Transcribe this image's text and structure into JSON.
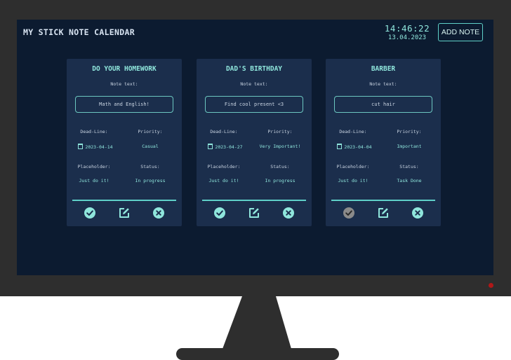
{
  "app": {
    "title": "MY STICK NOTE CALENDAR",
    "time": "14:46:22",
    "date": "13.04.2023",
    "add_note_label": "ADD NOTE"
  },
  "labels": {
    "note_text": "Note text:",
    "deadline": "Dead-Line:",
    "priority": "Priority:",
    "placeholder": "Placeholder:",
    "status": "Status:"
  },
  "colors": {
    "screen_bg": "#0c1b30",
    "card_bg": "#1b2e4c",
    "accent": "#8fe6dc",
    "done_gray": "#8a8a8a"
  },
  "notes": [
    {
      "title": "DO YOUR HOMEWORK",
      "text": "Math and English!",
      "deadline": "2023-04-14",
      "priority": "Casual",
      "placeholder": "Just do it!",
      "status": "In progress",
      "done": false
    },
    {
      "title": "DAD'S BIRTHDAY",
      "text": "Find cool present <3",
      "deadline": "2023-04-27",
      "priority": "Very Important!",
      "placeholder": "Just do it!",
      "status": "In progress",
      "done": false
    },
    {
      "title": "BARBER",
      "text": "cut hair",
      "deadline": "2023-04-04",
      "priority": "Important",
      "placeholder": "Just do it!",
      "status": "Task Done",
      "done": true
    }
  ]
}
